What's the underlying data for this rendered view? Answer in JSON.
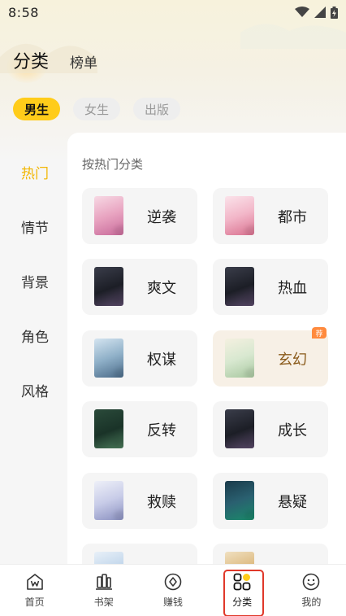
{
  "status_bar": {
    "time": "8:58",
    "icons": [
      "wifi-icon",
      "signal-icon",
      "battery-icon"
    ]
  },
  "top_tabs": {
    "active": "分类",
    "other": "榜单"
  },
  "gender_chips": [
    {
      "label": "男生",
      "active": true
    },
    {
      "label": "女生",
      "active": false
    },
    {
      "label": "出版",
      "active": false
    }
  ],
  "left_nav": [
    {
      "label": "热门",
      "active": true
    },
    {
      "label": "情节",
      "active": false
    },
    {
      "label": "背景",
      "active": false
    },
    {
      "label": "角色",
      "active": false
    },
    {
      "label": "风格",
      "active": false
    }
  ],
  "panel": {
    "heading": "按热门分类",
    "categories": [
      {
        "label": "逆袭",
        "cover": "cover-pink"
      },
      {
        "label": "都市",
        "cover": "cover-girl"
      },
      {
        "label": "爽文",
        "cover": "cover-dark"
      },
      {
        "label": "热血",
        "cover": "cover-dark"
      },
      {
        "label": "权谋",
        "cover": "cover-blue"
      },
      {
        "label": "玄幻",
        "cover": "cover-light",
        "badge": "荐"
      },
      {
        "label": "反转",
        "cover": "cover-green"
      },
      {
        "label": "成长",
        "cover": "cover-dark"
      },
      {
        "label": "救赎",
        "cover": "cover-white"
      },
      {
        "label": "悬疑",
        "cover": "cover-teal"
      }
    ]
  },
  "bottom_nav": [
    {
      "label": "首页",
      "icon": "home-icon",
      "active": false
    },
    {
      "label": "书架",
      "icon": "bookshelf-icon",
      "active": false
    },
    {
      "label": "赚钱",
      "icon": "coin-icon",
      "active": false
    },
    {
      "label": "分类",
      "icon": "category-grid-icon",
      "active": true
    },
    {
      "label": "我的",
      "icon": "smiley-icon",
      "active": false
    }
  ],
  "colors": {
    "accent": "#ffcc1a",
    "active_text": "#f2b705",
    "highlight_border": "#e0382a",
    "badge": "#ff8a3d"
  }
}
